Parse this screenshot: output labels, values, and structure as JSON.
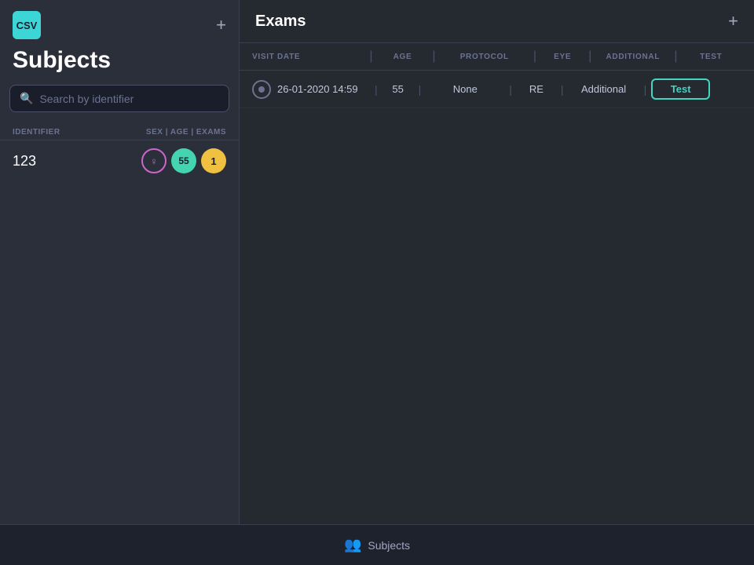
{
  "left_panel": {
    "logo_text": "CSV",
    "add_btn_label": "+",
    "title": "Subjects",
    "search_placeholder": "Search by identifier",
    "table_header": {
      "identifier": "IDENTIFIER",
      "sex_age_exams": "SEX | AGE | EXAMS"
    },
    "subjects": [
      {
        "id": "123",
        "sex_icon": "♀",
        "age": "55",
        "exams": "1"
      }
    ]
  },
  "right_panel": {
    "title": "Exams",
    "add_btn_label": "+",
    "columns": {
      "visit_date": "VISIT DATE",
      "age": "AGE",
      "protocol": "PROTOCOL",
      "eye": "EYE",
      "additional": "ADDITIONAL",
      "test": "TEST"
    },
    "exams": [
      {
        "visit_date": "26-01-2020 14:59",
        "age": "55",
        "protocol": "None",
        "eye": "RE",
        "additional": "Additional",
        "test_label": "Test"
      }
    ]
  },
  "bottom_nav": {
    "icon": "👥",
    "label": "Subjects"
  }
}
